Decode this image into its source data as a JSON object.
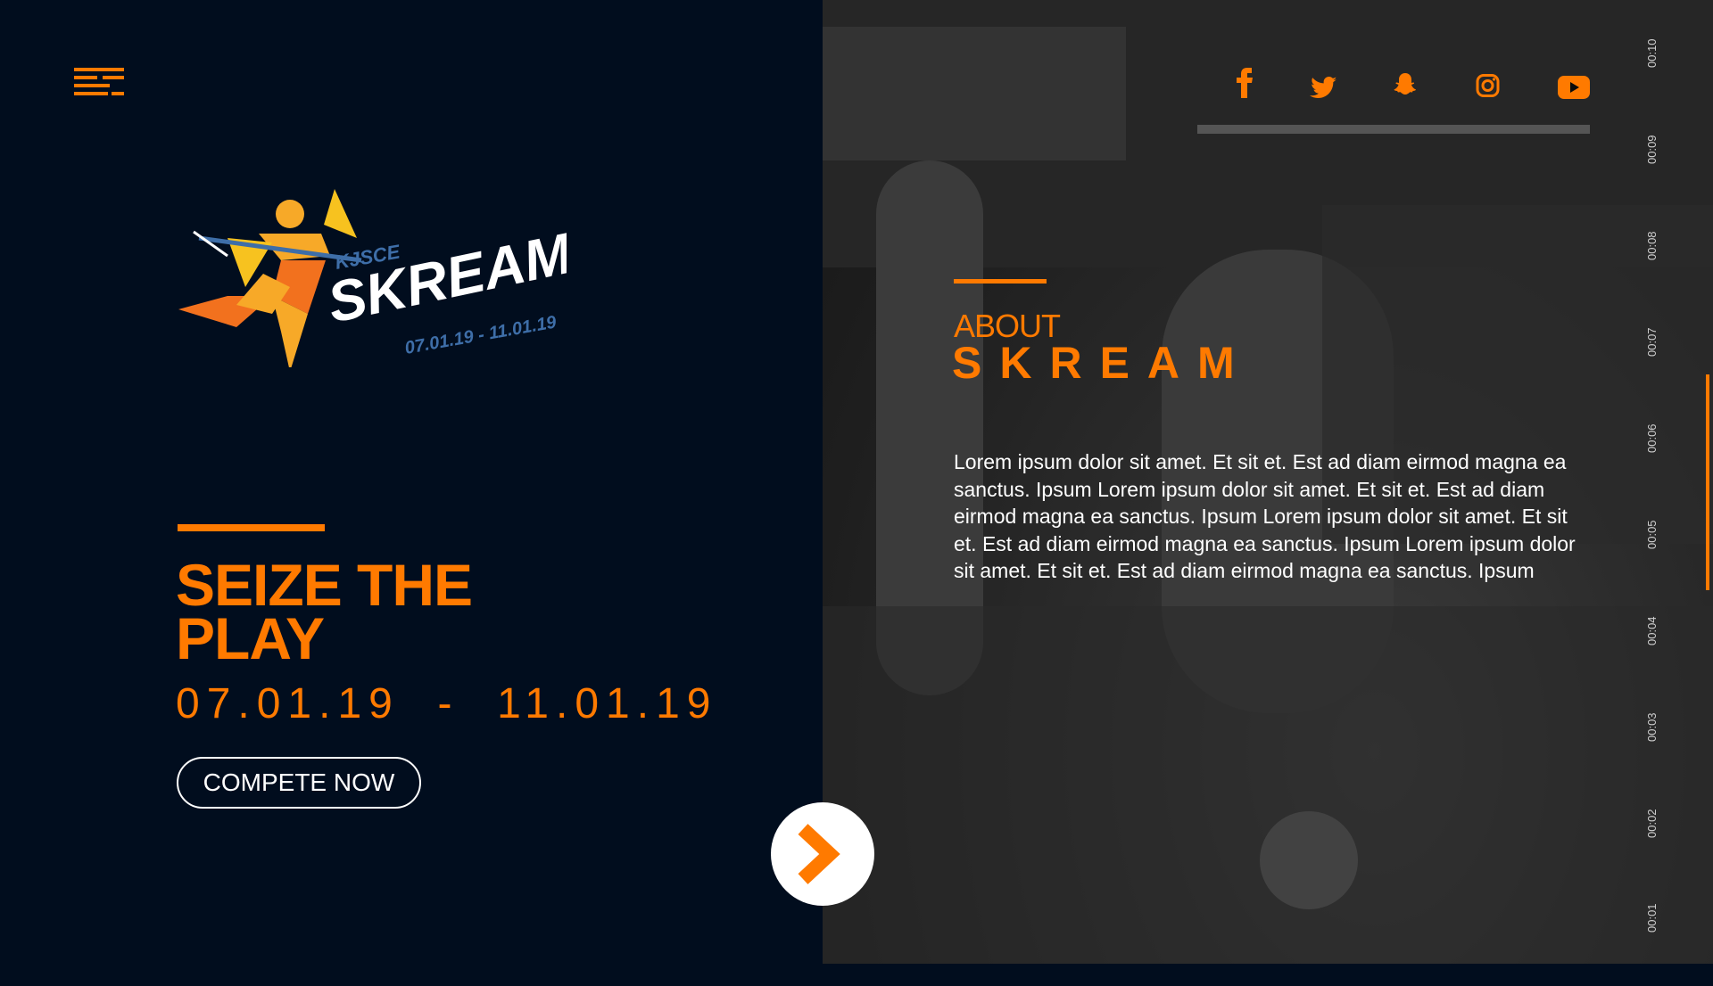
{
  "nav": {
    "menu_icon": "hamburger-menu-icon"
  },
  "logo": {
    "wordmark": "SKREAM",
    "prefix": "KJSCE",
    "dates": "07.01.19 - 11.01.19"
  },
  "hero": {
    "headline_line1": "SEIZE THE",
    "headline_line2": "PLAY",
    "dates": "07.01.19  -  11.01.19",
    "cta_label": "COMPETE NOW",
    "next_icon": "chevron-right-icon"
  },
  "social": [
    {
      "name": "facebook-icon"
    },
    {
      "name": "twitter-icon"
    },
    {
      "name": "snapchat-icon"
    },
    {
      "name": "instagram-icon"
    },
    {
      "name": "youtube-icon"
    }
  ],
  "about": {
    "label": "ABOUT",
    "title": "SKREAM",
    "body": "Lorem ipsum dolor sit amet. Et sit et. Est ad diam eirmod magna ea sanctus. Ipsum Lorem ipsum dolor sit amet. Et sit et. Est ad diam eirmod magna ea sanctus. Ipsum Lorem ipsum dolor sit amet. Et sit et. Est ad diam eirmod magna ea sanctus. Ipsum Lorem ipsum dolor sit amet. Et sit et. Est ad diam eirmod magna ea sanctus. Ipsum"
  },
  "timeline": [
    "00:10",
    "00:09",
    "00:08",
    "00:07",
    "00:06",
    "00:05",
    "00:04",
    "00:03",
    "00:02",
    "00:01"
  ],
  "colors": {
    "accent": "#ff7a00",
    "background": "#010d1e",
    "logo_blue": "#3e6ea8"
  }
}
